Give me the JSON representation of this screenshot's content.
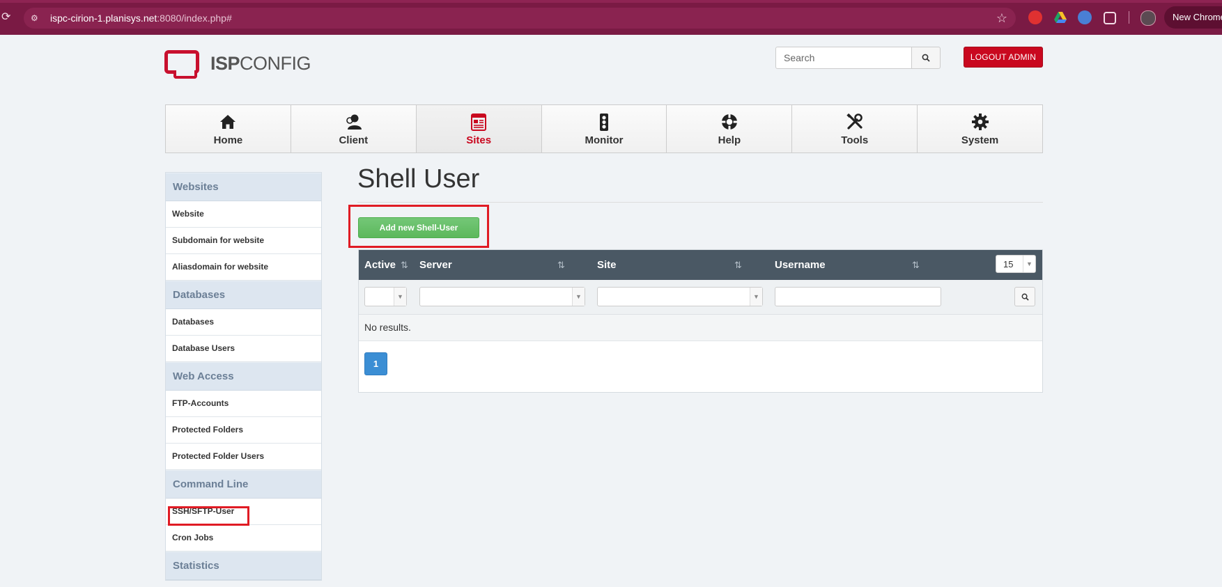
{
  "browser": {
    "url_host": "ispc-cirion-1.planisys.net",
    "url_rest": ":8080/index.php#",
    "new_chrome_label": "New Chrome"
  },
  "header": {
    "logo_bold": "ISP",
    "logo_light": "CONFIG",
    "search_placeholder": "Search",
    "logout_label": "LOGOUT ADMIN"
  },
  "nav": {
    "items": [
      {
        "label": "Home",
        "icon": "home-icon"
      },
      {
        "label": "Client",
        "icon": "user-icon"
      },
      {
        "label": "Sites",
        "icon": "sites-icon",
        "active": true
      },
      {
        "label": "Monitor",
        "icon": "traffic-light-icon"
      },
      {
        "label": "Help",
        "icon": "lifebuoy-icon"
      },
      {
        "label": "Tools",
        "icon": "tools-icon"
      },
      {
        "label": "System",
        "icon": "gear-icon"
      }
    ]
  },
  "sidebar": {
    "sections": [
      {
        "title": "Websites",
        "links": [
          "Website",
          "Subdomain for website",
          "Aliasdomain for website"
        ]
      },
      {
        "title": "Databases",
        "links": [
          "Databases",
          "Database Users"
        ]
      },
      {
        "title": "Web Access",
        "links": [
          "FTP-Accounts",
          "Protected Folders",
          "Protected Folder Users"
        ]
      },
      {
        "title": "Command Line",
        "links": [
          "SSH/SFTP-User",
          "Cron Jobs"
        ]
      },
      {
        "title": "Statistics",
        "links": []
      }
    ]
  },
  "main": {
    "title": "Shell User",
    "add_button": "Add new Shell-User",
    "columns": [
      "Active",
      "Server",
      "Site",
      "Username"
    ],
    "per_page": "15",
    "no_results": "No results.",
    "page": "1"
  },
  "colors": {
    "chrome": "#7a1a44",
    "accent_red": "#c9081f",
    "green": "#5cb85c",
    "grid_header": "#4a5864",
    "pager_blue": "#3b8ed4",
    "highlight": "#e01b24"
  }
}
